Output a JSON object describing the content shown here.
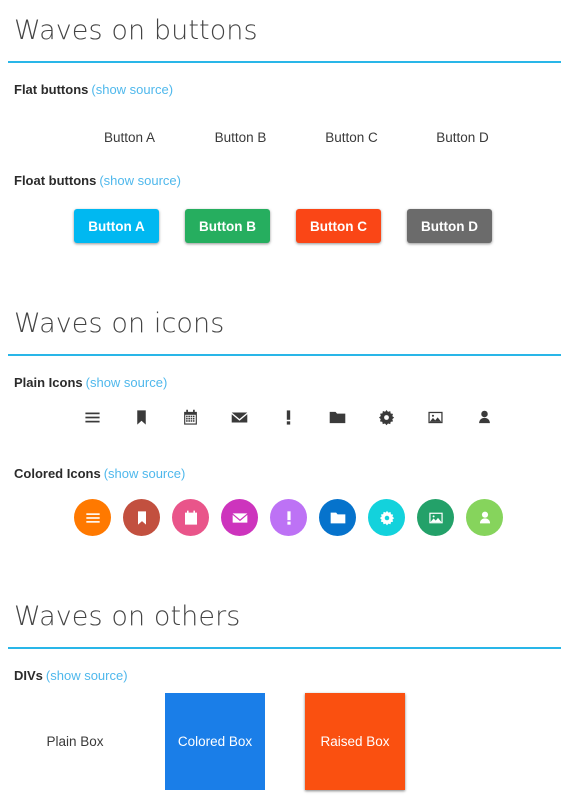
{
  "source_link_label": "(show source)",
  "accent_rule_color": "#29b6e8",
  "link_color": "#4fb8ec",
  "sections": [
    {
      "title": "Waves on buttons",
      "blocks": [
        {
          "label": "Flat buttons",
          "source_label": "(show source)"
        },
        {
          "label": "Float buttons",
          "source_label": "(show source)"
        }
      ]
    },
    {
      "title": "Waves on icons",
      "blocks": [
        {
          "label": "Plain Icons",
          "source_label": "(show source)"
        },
        {
          "label": "Colored Icons",
          "source_label": "(show source)"
        }
      ]
    },
    {
      "title": "Waves on others",
      "blocks": [
        {
          "label": "DIVs",
          "source_label": "(show source)"
        }
      ]
    }
  ],
  "flat_buttons": [
    {
      "label": "Button A"
    },
    {
      "label": "Button B"
    },
    {
      "label": "Button C"
    },
    {
      "label": "Button D"
    }
  ],
  "float_buttons": [
    {
      "label": "Button A",
      "color": "#00b8f1"
    },
    {
      "label": "Button B",
      "color": "#26ae5f"
    },
    {
      "label": "Button C",
      "color": "#fa4616"
    },
    {
      "label": "Button D",
      "color": "#6b6b6b"
    }
  ],
  "plain_icons": [
    {
      "name": "bars-icon"
    },
    {
      "name": "bookmark-icon"
    },
    {
      "name": "calendar-icon"
    },
    {
      "name": "envelope-icon"
    },
    {
      "name": "exclamation-icon"
    },
    {
      "name": "folder-icon"
    },
    {
      "name": "gear-icon"
    },
    {
      "name": "image-icon"
    },
    {
      "name": "user-icon"
    }
  ],
  "colored_icons": [
    {
      "name": "bars-icon",
      "color": "#ff7900"
    },
    {
      "name": "bookmark-icon",
      "color": "#c2503f"
    },
    {
      "name": "calendar-icon",
      "color": "#e9558a"
    },
    {
      "name": "envelope-icon",
      "color": "#cd34bd"
    },
    {
      "name": "exclamation-icon",
      "color": "#bd72f5"
    },
    {
      "name": "folder-icon",
      "color": "#0673cc"
    },
    {
      "name": "gear-icon",
      "color": "#13d2dc"
    },
    {
      "name": "image-icon",
      "color": "#23a169"
    },
    {
      "name": "user-icon",
      "color": "#86d45c"
    }
  ],
  "boxes": [
    {
      "label": "Plain Box",
      "color": "transparent"
    },
    {
      "label": "Colored Box",
      "color": "#1a7ee8"
    },
    {
      "label": "Raised Box",
      "color": "#fa5010"
    }
  ]
}
